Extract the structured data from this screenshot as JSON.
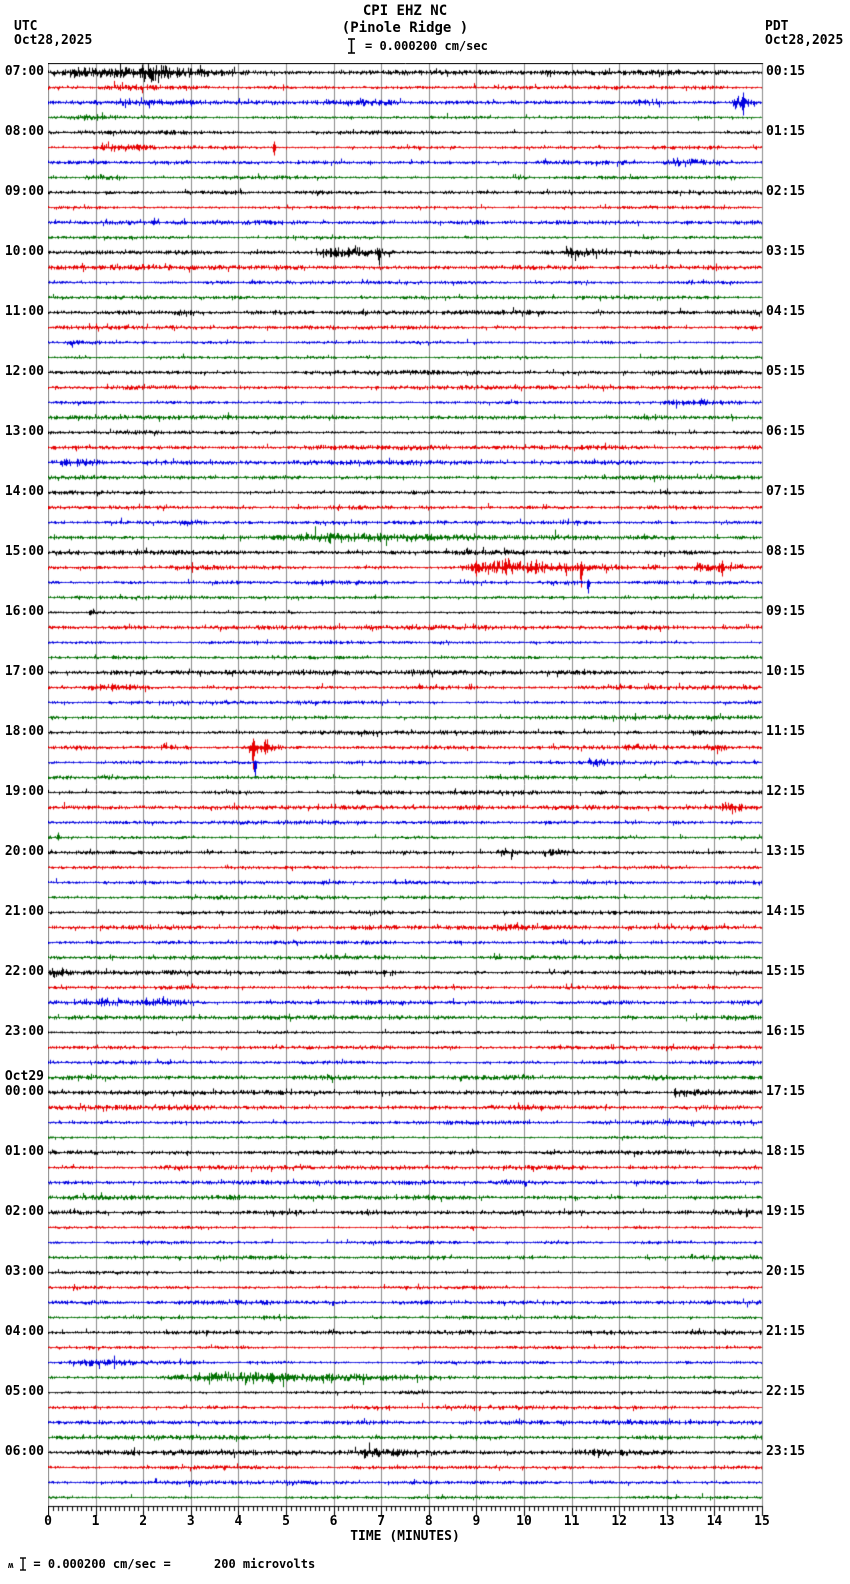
{
  "header": {
    "station": "CPI EHZ NC",
    "location": "(Pinole Ridge )",
    "scale_label": "= 0.000200 cm/sec",
    "left_tz": "UTC",
    "left_date": "Oct28,2025",
    "right_tz": "PDT",
    "right_date": "Oct28,2025"
  },
  "footer": {
    "note": "= 0.000200 cm/sec =      200 microvolts",
    "wave_glyph": "ʍ"
  },
  "axis": {
    "label": "TIME (MINUTES)",
    "tick_labels": [
      "0",
      "1",
      "2",
      "3",
      "4",
      "5",
      "6",
      "7",
      "8",
      "9",
      "10",
      "11",
      "12",
      "13",
      "14",
      "15"
    ],
    "min": 0,
    "max": 15,
    "major_tick": 1,
    "minor_tick": 0.1
  },
  "colors": {
    "trace_cycle": [
      "#000000",
      "#e60000",
      "#0000e0",
      "#007000"
    ],
    "grid": "#8a8a8a",
    "border": "#000000",
    "background": "#ffffff",
    "text": "#000000"
  },
  "chart_data": {
    "type": "line",
    "subtype": "helicorder-seismogram",
    "title": "CPI EHZ NC (Pinole Ridge )",
    "xlabel": "TIME (MINUTES)",
    "x_range_minutes": [
      0,
      15
    ],
    "traces_per_hour_row": 4,
    "minutes_per_trace": 15,
    "rows_utc": [
      "07:00",
      "08:00",
      "09:00",
      "10:00",
      "11:00",
      "12:00",
      "13:00",
      "14:00",
      "15:00",
      "16:00",
      "17:00",
      "18:00",
      "19:00",
      "20:00",
      "21:00",
      "22:00",
      "23:00",
      "00:00",
      "01:00",
      "02:00",
      "03:00",
      "04:00",
      "05:00",
      "06:00"
    ],
    "rows_pdt": [
      "00:15",
      "01:15",
      "02:15",
      "03:15",
      "04:15",
      "05:15",
      "06:15",
      "07:15",
      "08:15",
      "09:15",
      "10:15",
      "11:15",
      "12:15",
      "13:15",
      "14:15",
      "15:15",
      "16:15",
      "17:15",
      "18:15",
      "19:15",
      "20:15",
      "21:15",
      "22:15",
      "23:15"
    ],
    "date_break": {
      "row_index": 17,
      "label": "Oct29"
    },
    "events": [
      {
        "trace": 0,
        "kind": "burst",
        "start": 0,
        "end": 4.4,
        "amp": 3.2
      },
      {
        "trace": 0,
        "kind": "burst",
        "start": 1.9,
        "end": 2.75,
        "amp": 4.5
      },
      {
        "trace": 1,
        "kind": "burst",
        "start": 1.0,
        "end": 2.6,
        "amp": 1.3
      },
      {
        "trace": 2,
        "kind": "burst",
        "start": 1.3,
        "end": 2.7,
        "amp": 2.2
      },
      {
        "trace": 2,
        "kind": "burst",
        "start": 5.6,
        "end": 7.5,
        "amp": 1.5
      },
      {
        "trace": 2,
        "kind": "burst",
        "start": 12.2,
        "end": 13.2,
        "amp": 1.5
      },
      {
        "trace": 2,
        "kind": "burst",
        "start": 14.35,
        "end": 14.95,
        "amp": 4.0
      },
      {
        "trace": 2,
        "kind": "spike",
        "at": 14.6,
        "up": 10,
        "down": 13
      },
      {
        "trace": 3,
        "kind": "burst",
        "start": 0.4,
        "end": 1.6,
        "amp": 1.8
      },
      {
        "trace": 5,
        "kind": "burst",
        "start": 0.9,
        "end": 2.3,
        "amp": 2.6
      },
      {
        "trace": 5,
        "kind": "spike",
        "at": 4.75,
        "up": 6,
        "down": 8
      },
      {
        "trace": 6,
        "kind": "burst",
        "start": 12.9,
        "end": 13.9,
        "amp": 2.6
      },
      {
        "trace": 7,
        "kind": "burst",
        "start": 0.7,
        "end": 1.7,
        "amp": 2.2
      },
      {
        "trace": 7,
        "kind": "burst",
        "start": 9.7,
        "end": 10.15,
        "amp": 1.8
      },
      {
        "trace": 12,
        "kind": "burst",
        "start": 5.5,
        "end": 7.25,
        "amp": 3.2
      },
      {
        "trace": 12,
        "kind": "spike",
        "at": 6.95,
        "up": 4,
        "down": 13
      },
      {
        "trace": 12,
        "kind": "burst",
        "start": 10.8,
        "end": 11.75,
        "amp": 2.2
      },
      {
        "trace": 16,
        "kind": "burst",
        "start": 2.6,
        "end": 3.05,
        "amp": 1.8
      },
      {
        "trace": 18,
        "kind": "burst",
        "start": 0.3,
        "end": 1.2,
        "amp": 1.6
      },
      {
        "trace": 22,
        "kind": "burst",
        "start": 12.8,
        "end": 14.6,
        "amp": 1.6
      },
      {
        "trace": 26,
        "kind": "burst",
        "start": 0.2,
        "end": 1.05,
        "amp": 2.0
      },
      {
        "trace": 30,
        "kind": "burst",
        "start": 2.8,
        "end": 3.3,
        "amp": 2.2
      },
      {
        "trace": 31,
        "kind": "burst",
        "start": 3.9,
        "end": 13.2,
        "amp": 1.8
      },
      {
        "trace": 31,
        "kind": "burst",
        "start": 4.9,
        "end": 9.1,
        "amp": 1.6
      },
      {
        "trace": 33,
        "kind": "burst",
        "start": 2.4,
        "end": 4.2,
        "amp": 1.2
      },
      {
        "trace": 33,
        "kind": "burst",
        "start": 8.55,
        "end": 12.35,
        "amp": 4.2
      },
      {
        "trace": 33,
        "kind": "burst",
        "start": 12.35,
        "end": 13.45,
        "amp": 1.8
      },
      {
        "trace": 33,
        "kind": "burst",
        "start": 13.5,
        "end": 14.75,
        "amp": 3.8
      },
      {
        "trace": 33,
        "kind": "spike",
        "at": 9.0,
        "up": 7,
        "down": 9
      },
      {
        "trace": 33,
        "kind": "spike",
        "at": 9.6,
        "up": 9,
        "down": 5
      },
      {
        "trace": 33,
        "kind": "spike",
        "at": 10.25,
        "up": 8,
        "down": 6
      },
      {
        "trace": 33,
        "kind": "spike",
        "at": 11.2,
        "up": 6,
        "down": 20
      },
      {
        "trace": 33,
        "kind": "spike",
        "at": 14.15,
        "up": 7,
        "down": 9
      },
      {
        "trace": 34,
        "kind": "spike",
        "at": 11.35,
        "up": 3,
        "down": 11
      },
      {
        "trace": 36,
        "kind": "burst",
        "start": 0.8,
        "end": 1.3,
        "amp": 2.2
      },
      {
        "trace": 40,
        "kind": "burst",
        "start": 0,
        "end": 15,
        "amp": 0.7
      },
      {
        "trace": 41,
        "kind": "burst",
        "start": 0.75,
        "end": 2.1,
        "amp": 2.2
      },
      {
        "trace": 41,
        "kind": "spike",
        "at": 1.35,
        "up": 4,
        "down": 4
      },
      {
        "trace": 45,
        "kind": "burst",
        "start": 2.3,
        "end": 3.1,
        "amp": 1.8
      },
      {
        "trace": 45,
        "kind": "burst",
        "start": 4.1,
        "end": 4.95,
        "amp": 5.5
      },
      {
        "trace": 45,
        "kind": "spike",
        "at": 4.3,
        "up": 9,
        "down": 22
      },
      {
        "trace": 45,
        "kind": "spike",
        "at": 4.55,
        "up": 8,
        "down": 7
      },
      {
        "trace": 45,
        "kind": "burst",
        "start": 12.1,
        "end": 13.1,
        "amp": 1.8
      },
      {
        "trace": 45,
        "kind": "burst",
        "start": 13.8,
        "end": 14.4,
        "amp": 2.2
      },
      {
        "trace": 46,
        "kind": "spike",
        "at": 4.35,
        "up": 2,
        "down": 16
      },
      {
        "trace": 46,
        "kind": "burst",
        "start": 11.3,
        "end": 11.75,
        "amp": 2.8
      },
      {
        "trace": 49,
        "kind": "burst",
        "start": 14.1,
        "end": 14.7,
        "amp": 3.0
      },
      {
        "trace": 51,
        "kind": "spike",
        "at": 0.2,
        "up": 5,
        "down": 3
      },
      {
        "trace": 52,
        "kind": "burst",
        "start": 9.4,
        "end": 9.9,
        "amp": 3.2
      },
      {
        "trace": 52,
        "kind": "burst",
        "start": 10.4,
        "end": 11.05,
        "amp": 2.2
      },
      {
        "trace": 57,
        "kind": "burst",
        "start": 9.3,
        "end": 10.2,
        "amp": 1.4
      },
      {
        "trace": 60,
        "kind": "burst",
        "start": 0,
        "end": 0.5,
        "amp": 2.8
      },
      {
        "trace": 62,
        "kind": "burst",
        "start": 1.0,
        "end": 1.55,
        "amp": 1.6
      },
      {
        "trace": 62,
        "kind": "burst",
        "start": 2.0,
        "end": 3.3,
        "amp": 2.0
      },
      {
        "trace": 62,
        "kind": "spike",
        "at": 2.05,
        "up": 5,
        "down": 3
      },
      {
        "trace": 65,
        "kind": "spike",
        "at": 10.75,
        "up": 3,
        "down": 2
      },
      {
        "trace": 68,
        "kind": "burst",
        "start": 13.05,
        "end": 13.8,
        "amp": 2.8
      },
      {
        "trace": 86,
        "kind": "burst",
        "start": 0.4,
        "end": 2.2,
        "amp": 1.7
      },
      {
        "trace": 87,
        "kind": "burst",
        "start": 2.3,
        "end": 8.3,
        "amp": 2.2
      },
      {
        "trace": 87,
        "kind": "burst",
        "start": 4.0,
        "end": 5.2,
        "amp": 1.5
      },
      {
        "trace": 92,
        "kind": "burst",
        "start": 0,
        "end": 15,
        "amp": 1.2
      },
      {
        "trace": 92,
        "kind": "burst",
        "start": 6.4,
        "end": 7.6,
        "amp": 1.8
      },
      {
        "trace": 92,
        "kind": "burst",
        "start": 11.0,
        "end": 13.2,
        "amp": 1.4
      }
    ]
  }
}
